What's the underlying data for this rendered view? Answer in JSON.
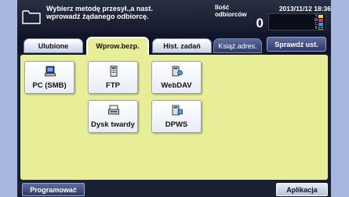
{
  "header": {
    "prompt_line1": "Wybierz metodę przesył.,a nast.",
    "prompt_line2": "wprowadź żądanego odbiorcę.",
    "recipients_label_line1": "Ilość",
    "recipients_label_line2": "odbiorców",
    "recipients_count": "0",
    "datetime": "2013/11/12 18:36",
    "toner_letters": [
      "Y",
      "M",
      "C",
      "K"
    ],
    "toner_colors": [
      "#f2e600",
      "#e0208a",
      "#1aa3e0",
      "#222222"
    ]
  },
  "tabs": [
    {
      "label": "Ulubione"
    },
    {
      "label": "Wprow.bezp."
    },
    {
      "label": "Hist. zadań"
    },
    {
      "label": "Książ.adres."
    }
  ],
  "check_settings_label": "Sprawdź ust.",
  "methods": [
    {
      "label": "PC (SMB)",
      "icon": "pc-icon"
    },
    {
      "label": "FTP",
      "icon": "ftp-icon"
    },
    {
      "label": "WebDAV",
      "icon": "webdav-icon"
    },
    {
      "label": "Dysk twardy",
      "icon": "hard-disk-icon"
    },
    {
      "label": "DPWS",
      "icon": "dpws-icon"
    }
  ],
  "footer": {
    "program_label": "Programować",
    "application_label": "Aplikacja"
  },
  "colors": {
    "accent_panel": "#e7ee97",
    "header_bg": "#1a2033",
    "background": "#a8b7df"
  }
}
